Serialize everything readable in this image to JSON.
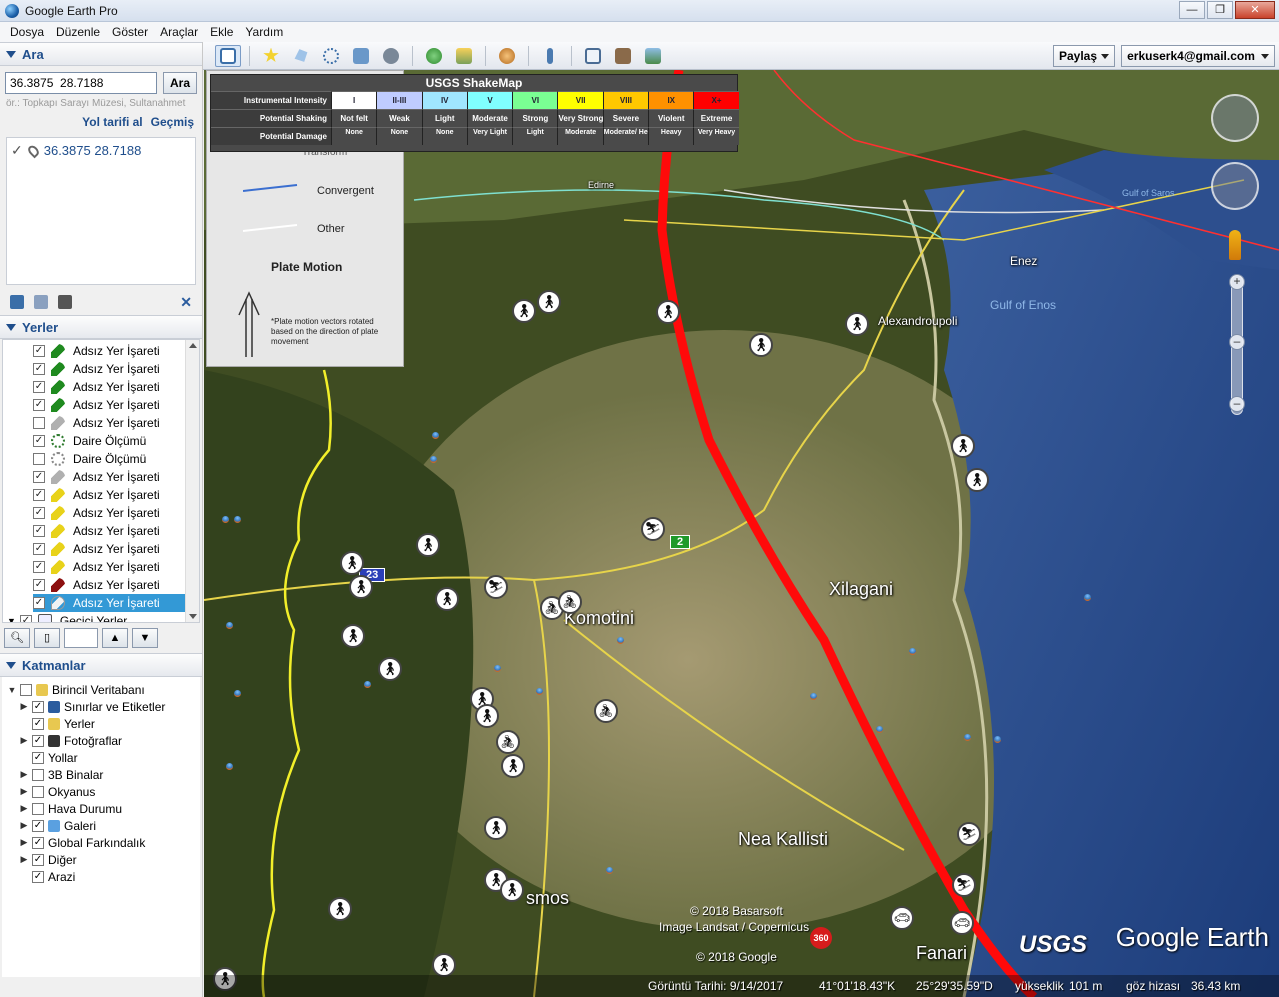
{
  "window": {
    "title": "Google Earth Pro"
  },
  "menu": [
    "Dosya",
    "Düzenle",
    "Göster",
    "Araçlar",
    "Ekle",
    "Yardım"
  ],
  "search": {
    "header": "Ara",
    "value": "36.3875  28.7188",
    "button": "Ara",
    "hint": "ör.: Topkapı Sarayı Müzesi, Sultanahmet",
    "directions_link": "Yol tarifi al",
    "history_link": "Geçmiş",
    "result": "36.3875 28.7188"
  },
  "places": {
    "header": "Yerler",
    "items": [
      {
        "label": "Adsız Yer İşareti",
        "checked": true,
        "icon": "pin-green"
      },
      {
        "label": "Adsız Yer İşareti",
        "checked": true,
        "icon": "pin-green"
      },
      {
        "label": "Adsız Yer İşareti",
        "checked": true,
        "icon": "pin-green"
      },
      {
        "label": "Adsız Yer İşareti",
        "checked": true,
        "icon": "pin-green"
      },
      {
        "label": "Adsız Yer İşareti",
        "checked": false,
        "icon": "pin-grey"
      },
      {
        "label": "Daire Ölçümü",
        "checked": true,
        "icon": "circle-measure"
      },
      {
        "label": "Daire Ölçümü",
        "checked": false,
        "icon": "circle-measure-grey"
      },
      {
        "label": "Adsız Yer İşareti",
        "checked": true,
        "icon": "pin-grey"
      },
      {
        "label": "Adsız Yer İşareti",
        "checked": true,
        "icon": "pin-yellow"
      },
      {
        "label": "Adsız Yer İşareti",
        "checked": true,
        "icon": "pin-yellow"
      },
      {
        "label": "Adsız Yer İşareti",
        "checked": true,
        "icon": "pin-yellow"
      },
      {
        "label": "Adsız Yer İşareti",
        "checked": true,
        "icon": "pin-yellow"
      },
      {
        "label": "Adsız Yer İşareti",
        "checked": true,
        "icon": "pin-yellow"
      },
      {
        "label": "Adsız Yer İşareti",
        "checked": true,
        "icon": "pin-red"
      },
      {
        "label": "Adsız Yer İşareti",
        "checked": true,
        "icon": "pin-white",
        "selected": true
      }
    ],
    "temp_places": "Geçici Yerler"
  },
  "layers": {
    "header": "Katmanlar",
    "items": [
      {
        "label": "Birincil Veritabanı",
        "checked": false,
        "expand": "-",
        "indent": 0
      },
      {
        "label": "Sınırlar ve Etiketler",
        "checked": true,
        "expand": "+",
        "indent": 1
      },
      {
        "label": "Yerler",
        "checked": true,
        "expand": "",
        "indent": 1
      },
      {
        "label": "Fotoğraflar",
        "checked": true,
        "expand": "+",
        "indent": 1
      },
      {
        "label": "Yollar",
        "checked": true,
        "expand": "",
        "indent": 1
      },
      {
        "label": "3B Binalar",
        "checked": false,
        "expand": "+",
        "indent": 1
      },
      {
        "label": "Okyanus",
        "checked": false,
        "expand": "+",
        "indent": 1
      },
      {
        "label": "Hava Durumu",
        "checked": false,
        "expand": "+",
        "indent": 1
      },
      {
        "label": "Galeri",
        "checked": true,
        "expand": "+",
        "indent": 1
      },
      {
        "label": "Global Farkındalık",
        "checked": true,
        "expand": "+",
        "indent": 1
      },
      {
        "label": "Diğer",
        "checked": true,
        "expand": "+",
        "indent": 1
      },
      {
        "label": "Arazi",
        "checked": true,
        "expand": "",
        "indent": 1
      }
    ]
  },
  "toolbar": {
    "share": "Paylaş",
    "account": "erkuserk4@gmail.com"
  },
  "legend": {
    "convergent": "Convergent",
    "other": "Other",
    "plate_motion": "Plate Motion",
    "note": "*Plate motion vectors rotated based on the direction of plate movement",
    "partial_top": "Transform"
  },
  "shakemap": {
    "title": "USGS ShakeMap",
    "row_labels": [
      "Instrumental Intensity",
      "Potential Shaking",
      "Potential Damage"
    ],
    "intensity": [
      "I",
      "II-III",
      "IV",
      "V",
      "VI",
      "VII",
      "VIII",
      "IX",
      "X+"
    ],
    "shaking": [
      "Not felt",
      "Weak",
      "Light",
      "Moderate",
      "Strong",
      "Very Strong",
      "Severe",
      "Violent",
      "Extreme"
    ],
    "damage": [
      "None",
      "None",
      "None",
      "Very Light",
      "Light",
      "Moderate",
      "Moderate/ Heavy",
      "Heavy",
      "Very Heavy"
    ],
    "colors": [
      "#ffffff",
      "#bfccff",
      "#a0e6ff",
      "#80ffff",
      "#7aff93",
      "#ffff00",
      "#ffc800",
      "#ff9100",
      "#ff0000"
    ]
  },
  "map": {
    "places": [
      "Komotini",
      "Xilagani",
      "Nea Kallisti",
      "smos",
      "Fanari"
    ],
    "small_places": [
      "Alexandroupoli",
      "Enez",
      "Edirne"
    ],
    "water": [
      "Gulf of Enos",
      "Gulf of Saros"
    ],
    "shields": [
      "23",
      "2"
    ],
    "attribution": [
      "© 2018 Basarsoft",
      "Image Landsat / Copernicus",
      "© 2018 Google"
    ],
    "logo": "Google Earth",
    "usgs": "USGS",
    "badge": "360"
  },
  "status": {
    "date_label": "Görüntü Tarihi: 9/14/2017",
    "lat": "41°01'18.43\"K",
    "lon": "25°29'35.59\"D",
    "elev_label": "yükseklik",
    "elev": "101 m",
    "eye_label": "göz hizası",
    "eye": "36.43 km"
  }
}
